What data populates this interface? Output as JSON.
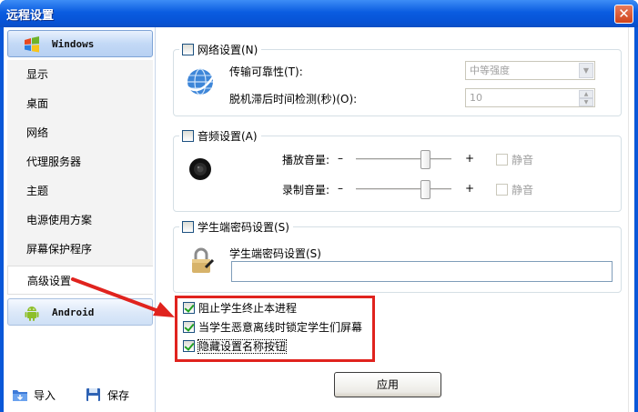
{
  "window": {
    "title": "远程设置",
    "close_glyph": "✕"
  },
  "sidebar": {
    "windows_header": "Windows",
    "android_header": "Android",
    "items": [
      "显示",
      "桌面",
      "网络",
      "代理服务器",
      "主题",
      "电源使用方案",
      "屏幕保护程序",
      "高级设置"
    ],
    "selected_index": 7,
    "import_label": "导入",
    "save_label": "保存"
  },
  "network": {
    "legend": "网络设置(N)",
    "checked": false,
    "reliability_label": "传输可靠性(T):",
    "reliability_value": "中等强度",
    "timeout_label": "脱机滞后时间检测(秒)(O):",
    "timeout_value": "10"
  },
  "audio": {
    "legend": "音频设置(A)",
    "checked": false,
    "play_label": "播放音量:",
    "record_label": "录制音量:",
    "minus": "–",
    "plus": "+",
    "mute_label": "静音",
    "play_level": 0.75,
    "record_level": 0.75
  },
  "password": {
    "legend": "学生端密码设置(S)",
    "checked": false,
    "field_label": "学生端密码设置(S)",
    "field_value": ""
  },
  "options": [
    {
      "label": "阻止学生终止本进程",
      "checked": true
    },
    {
      "label": "当学生恶意离线时锁定学生们屏幕",
      "checked": true
    },
    {
      "label": "隐藏设置名称按钮",
      "checked": true
    }
  ],
  "apply_label": "应用",
  "colors": {
    "title_bar": "#0a5ce0",
    "highlight": "#e0231e",
    "arrow": "#e0231e"
  }
}
